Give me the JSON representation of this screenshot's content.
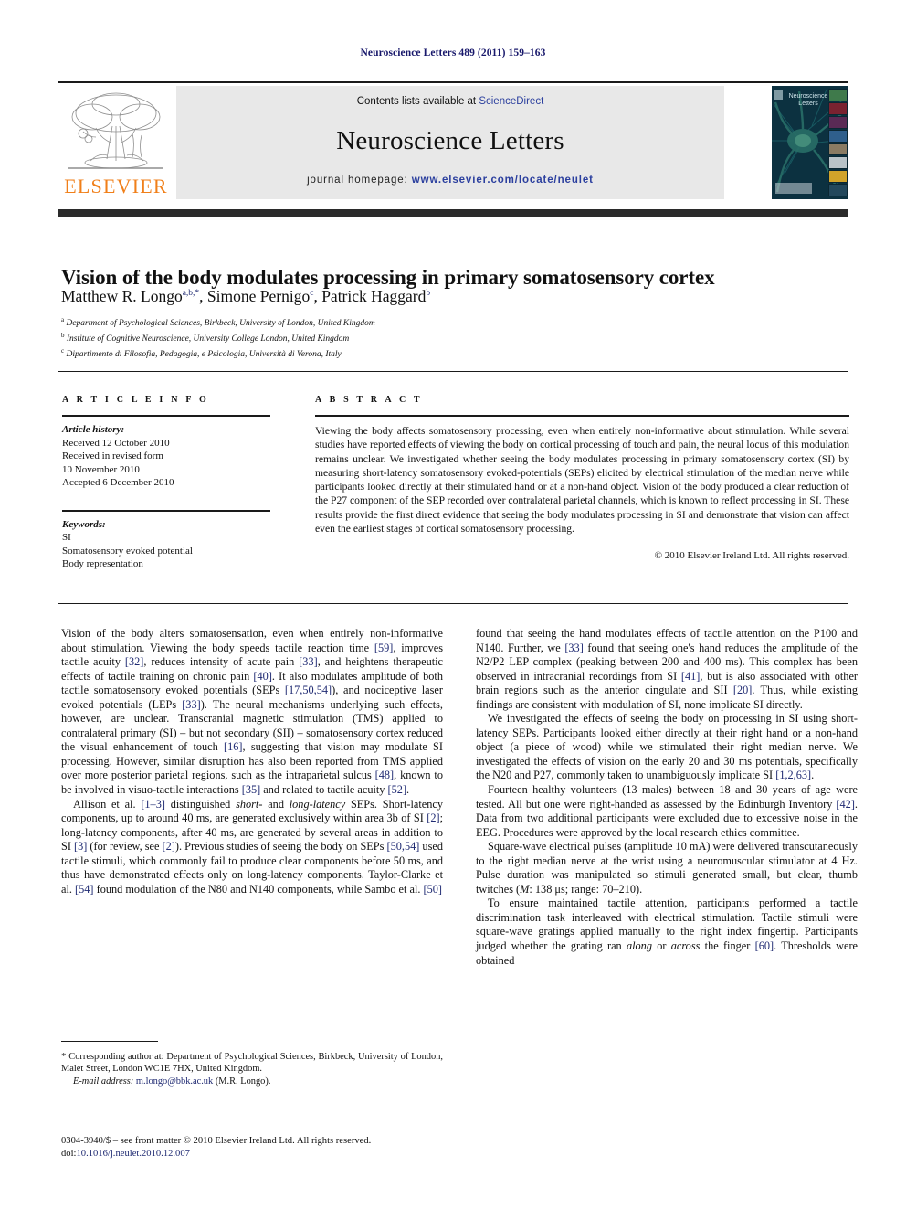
{
  "running_head": "Neuroscience Letters 489 (2011) 159–163",
  "header": {
    "publisher_logo_name": "ELSEVIER",
    "contents_prefix": "Contents lists available at ",
    "contents_link": "ScienceDirect",
    "journal_name": "Neuroscience Letters",
    "homepage_prefix": "journal homepage:",
    "homepage_url": "www.elsevier.com/locate/neulet",
    "cover_title": "Neuroscience Letters",
    "accent_link_color": "#2b3f9e",
    "elsevier_orange": "#f07f19",
    "cover_bg_color": "#0c2f3d"
  },
  "article": {
    "title": "Vision of the body modulates processing in primary somatosensory cortex",
    "authors_html": "Matthew R. Longo<sup>a,b,*</sup>, Simone Pernigo<sup>c</sup>, Patrick Haggard<sup>b</sup>",
    "affiliations": [
      {
        "marker": "a",
        "text": "Department of Psychological Sciences, Birkbeck, University of London, United Kingdom"
      },
      {
        "marker": "b",
        "text": "Institute of Cognitive Neuroscience, University College London, United Kingdom"
      },
      {
        "marker": "c",
        "text": "Dipartimento di Filosofia, Pedagogia, e Psicologia, Università di Verona, Italy"
      }
    ]
  },
  "article_info": {
    "heading": "A R T I C L E    I N F O",
    "history_label": "Article history:",
    "history_lines": [
      "Received 12 October 2010",
      "Received in revised form",
      "10 November 2010",
      "Accepted 6 December 2010"
    ],
    "keywords_label": "Keywords:",
    "keywords": [
      "SI",
      "Somatosensory evoked potential",
      "Body representation"
    ]
  },
  "abstract": {
    "heading": "A B S T R A C T",
    "text": "Viewing the body affects somatosensory processing, even when entirely non-informative about stimulation. While several studies have reported effects of viewing the body on cortical processing of touch and pain, the neural locus of this modulation remains unclear. We investigated whether seeing the body modulates processing in primary somatosensory cortex (SI) by measuring short-latency somatosensory evoked-potentials (SEPs) elicited by electrical stimulation of the median nerve while participants looked directly at their stimulated hand or at a non-hand object. Vision of the body produced a clear reduction of the P27 component of the SEP recorded over contralateral parietal channels, which is known to reflect processing in SI. These results provide the first direct evidence that seeing the body modulates processing in SI and demonstrate that vision can affect even the earliest stages of cortical somatosensory processing.",
    "copyright": "© 2010 Elsevier Ireland Ltd. All rights reserved."
  },
  "body": {
    "left_column_html": [
      "Vision of the body alters somatosensation, even when entirely non-informative about stimulation. Viewing the body speeds tactile reaction time <span class=\"ref\">[59]</span>, improves tactile acuity <span class=\"ref\">[32]</span>, reduces intensity of acute pain <span class=\"ref\">[33]</span>, and heightens therapeutic effects of tactile training on chronic pain <span class=\"ref\">[40]</span>. It also modulates amplitude of both tactile somatosensory evoked potentials (SEPs <span class=\"ref\">[17,50,54]</span>), and nociceptive laser evoked potentials (LEPs <span class=\"ref\">[33]</span>). The neural mechanisms underlying such effects, however, are unclear. Transcranial magnetic stimulation (TMS) applied to contralateral primary (SI) – but not secondary (SII) – somatosensory cortex reduced the visual enhancement of touch <span class=\"ref\">[16]</span>, suggesting that vision may modulate SI processing. However, similar disruption has also been reported from TMS applied over more posterior parietal regions, such as the intraparietal sulcus <span class=\"ref\">[48]</span>, known to be involved in visuo-tactile interactions <span class=\"ref\">[35]</span> and related to tactile acuity <span class=\"ref\">[52]</span>.",
      "Allison et al. <span class=\"ref\">[1–3]</span> distinguished <i>short-</i> and <i>long-latency</i> SEPs. Short-latency components, up to around 40 ms, are generated exclusively within area 3b of SI <span class=\"ref\">[2]</span>; long-latency components, after 40 ms, are generated by several areas in addition to SI <span class=\"ref\">[3]</span> (for review, see <span class=\"ref\">[2]</span>). Previous studies of seeing the body on SEPs <span class=\"ref\">[50,54]</span> used tactile stimuli, which commonly fail to produce clear components before 50 ms, and thus have demonstrated effects only on long-latency components. Taylor-Clarke et al. <span class=\"ref\">[54]</span> found modulation of the N80 and N140 components, while Sambo et al. <span class=\"ref\">[50]</span>"
    ],
    "right_column_html": [
      "found that seeing the hand modulates effects of tactile attention on the P100 and N140. Further, we <span class=\"ref\">[33]</span> found that seeing one's hand reduces the amplitude of the N2/P2 LEP complex (peaking between 200 and 400 ms). This complex has been observed in intracranial recordings from SI <span class=\"ref\">[41]</span>, but is also associated with other brain regions such as the anterior cingulate and SII <span class=\"ref\">[20]</span>. Thus, while existing findings are consistent with modulation of SI, none implicate SI directly.",
      "We investigated the effects of seeing the body on processing in SI using short-latency SEPs. Participants looked either directly at their right hand or a non-hand object (a piece of wood) while we stimulated their right median nerve. We investigated the effects of vision on the early 20 and 30 ms potentials, specifically the N20 and P27, commonly taken to unambiguously implicate SI <span class=\"ref\">[1,2,63]</span>.",
      "Fourteen healthy volunteers (13 males) between 18 and 30 years of age were tested. All but one were right-handed as assessed by the Edinburgh Inventory <span class=\"ref\">[42]</span>. Data from two additional participants were excluded due to excessive noise in the EEG. Procedures were approved by the local research ethics committee.",
      "Square-wave electrical pulses (amplitude 10 mA) were delivered transcutaneously to the right median nerve at the wrist using a neuromuscular stimulator at 4 Hz. Pulse duration was manipulated so stimuli generated small, but clear, thumb twitches (<i>M</i>: 138 μs; range: 70–210).",
      "To ensure maintained tactile attention, participants performed a tactile discrimination task interleaved with electrical stimulation. Tactile stimuli were square-wave gratings applied manually to the right index fingertip. Participants judged whether the grating ran <i>along</i> or <i>across</i> the finger <span class=\"ref\">[60]</span>. Thresholds were obtained"
    ]
  },
  "footnote": {
    "corresponding_html": "<span class=\"star\">*</span> Corresponding author at: Department of Psychological Sciences, Birkbeck, University of London, Malet Street, London WC1E 7HX, United Kingdom.",
    "email_label": "E-mail address:",
    "email": "m.longo@bbk.ac.uk",
    "email_owner": "(M.R. Longo)."
  },
  "imprint": {
    "issn_line": "0304-3940/$ – see front matter © 2010 Elsevier Ireland Ltd. All rights reserved.",
    "doi_label": "doi:",
    "doi": "10.1016/j.neulet.2010.12.007"
  }
}
